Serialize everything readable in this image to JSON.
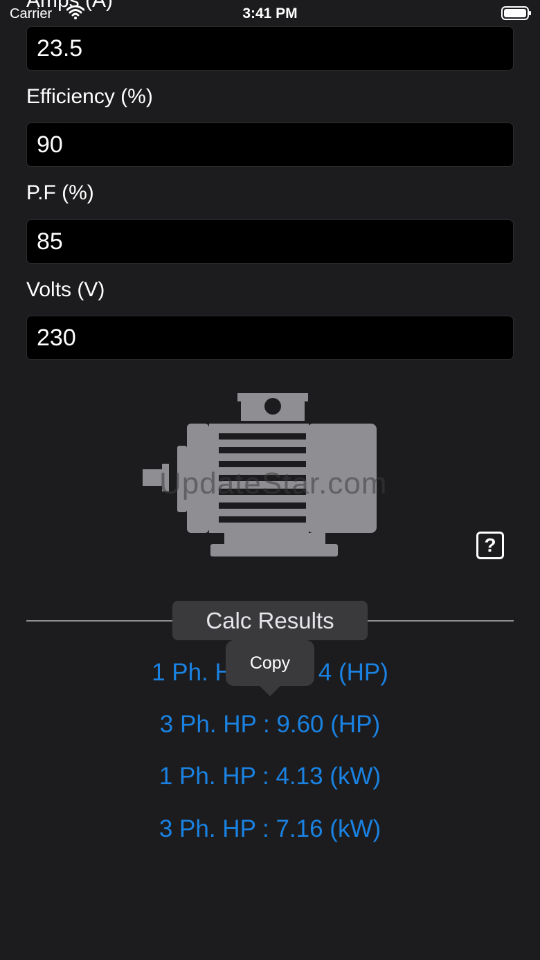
{
  "status_bar": {
    "carrier": "Carrier",
    "time": "3:41 PM",
    "icons": [
      "wifi-icon",
      "battery-icon"
    ]
  },
  "form": {
    "amps_label": "Amps (A)",
    "amps_value": "23.5",
    "efficiency_label": "Efficiency (%)",
    "efficiency_value": "90",
    "pf_label": "P.F (%)",
    "pf_value": "85",
    "volts_label": "Volts (V)",
    "volts_value": "230"
  },
  "graphic": {
    "icon": "electric-motor-icon",
    "watermark": "UpdateStar.com"
  },
  "help": {
    "label": "?"
  },
  "results": {
    "header": "Calc Results",
    "lines": [
      {
        "prefix": "1 Ph. H",
        "suffix": "4 (HP)"
      },
      {
        "text": "3 Ph. HP : 9.60 (HP)"
      },
      {
        "text": "1 Ph. HP : 4.13 (kW)"
      },
      {
        "text": "3 Ph. HP : 7.16 (kW)"
      }
    ]
  },
  "context_menu": {
    "copy": "Copy"
  },
  "colors": {
    "background": "#1c1c1e",
    "accent": "#1a82e2",
    "input_bg": "#000000",
    "panel": "#3a3a3c"
  }
}
